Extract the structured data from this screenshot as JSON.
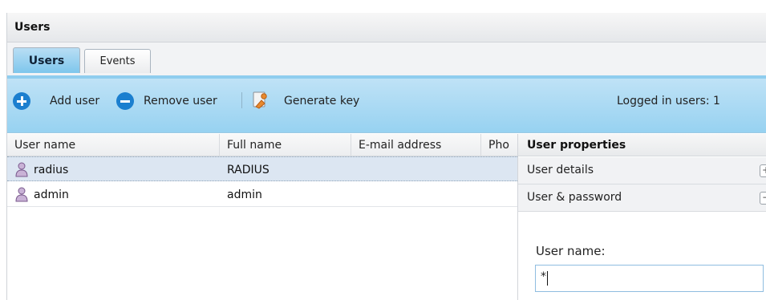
{
  "window": {
    "title": "Users"
  },
  "tabs": [
    {
      "label": "Users",
      "active": true
    },
    {
      "label": "Events",
      "active": false
    }
  ],
  "toolbar": {
    "add_label": "Add user",
    "add_icon": "plus-circle-icon",
    "remove_label": "Remove user",
    "remove_icon": "minus-circle-icon",
    "separator": "|",
    "generate_label": "Generate key",
    "generate_icon": "key-document-icon",
    "logged_in": "Logged in users: 1"
  },
  "grid": {
    "columns": [
      "User name",
      "Full name",
      "E-mail address",
      "Pho"
    ],
    "rows": [
      {
        "user_name": "radius",
        "full_name": "RADIUS",
        "email": "",
        "phone": "",
        "selected": true
      },
      {
        "user_name": "admin",
        "full_name": "admin",
        "email": "",
        "phone": "",
        "selected": false
      }
    ]
  },
  "properties": {
    "title": "User properties",
    "sections": [
      {
        "label": "User details",
        "toggle": "+"
      },
      {
        "label": "User & password",
        "toggle": "−"
      }
    ],
    "user_name_label": "User name:",
    "user_name_value": "*"
  },
  "colors": {
    "toolbar_bg": "#a9daf3",
    "accent_icon": "#1b7fcf",
    "selected_row": "#dce6f2"
  }
}
